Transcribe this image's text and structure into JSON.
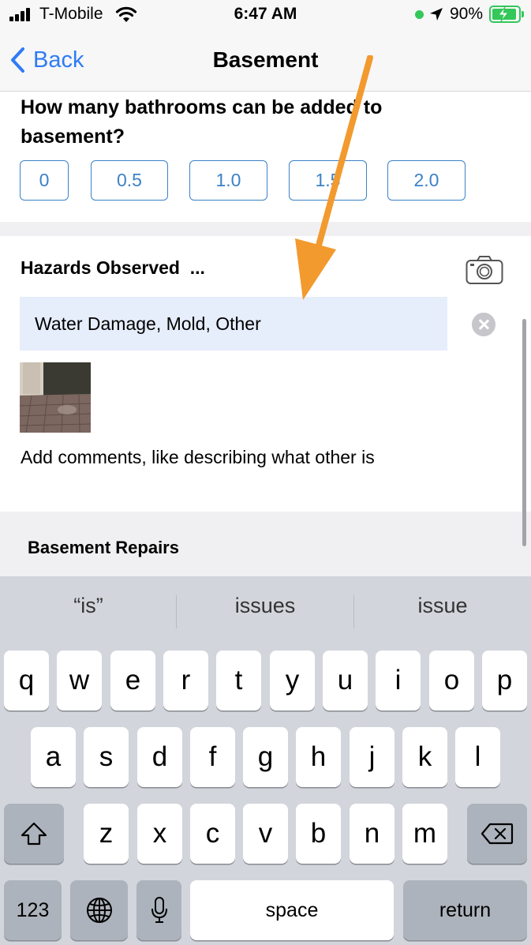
{
  "status_bar": {
    "carrier": "T-Mobile",
    "time": "6:47 AM",
    "battery_percent": "90%",
    "icons": [
      "signal-icon",
      "wifi-icon",
      "camera-in-use-dot",
      "location-arrow-icon",
      "battery-charging-icon"
    ],
    "battery_color": "#34c759"
  },
  "nav": {
    "back_label": "Back",
    "title": "Basement"
  },
  "bathrooms": {
    "question": "How many bathrooms can be added to basement?",
    "options": [
      "0",
      "0.5",
      "1.0",
      "1.5",
      "2.0"
    ],
    "accent_color": "#3b82c8"
  },
  "hazards": {
    "title": "Hazards Observed",
    "ellipsis": "...",
    "selected_value": "Water Damage, Mold, Other",
    "comments_text": "Add comments, like describing what other is",
    "field_bg": "#e6edfb"
  },
  "repairs": {
    "title": "Basement Repairs"
  },
  "annotation": {
    "arrow_color": "#f29a2e"
  },
  "keyboard": {
    "suggestions": [
      "“is”",
      "issues",
      "issue"
    ],
    "row1": [
      "q",
      "w",
      "e",
      "r",
      "t",
      "y",
      "u",
      "i",
      "o",
      "p"
    ],
    "row2": [
      "a",
      "s",
      "d",
      "f",
      "g",
      "h",
      "j",
      "k",
      "l"
    ],
    "row3": [
      "z",
      "x",
      "c",
      "v",
      "b",
      "n",
      "m"
    ],
    "key_123": "123",
    "space_label": "space",
    "return_label": "return"
  }
}
